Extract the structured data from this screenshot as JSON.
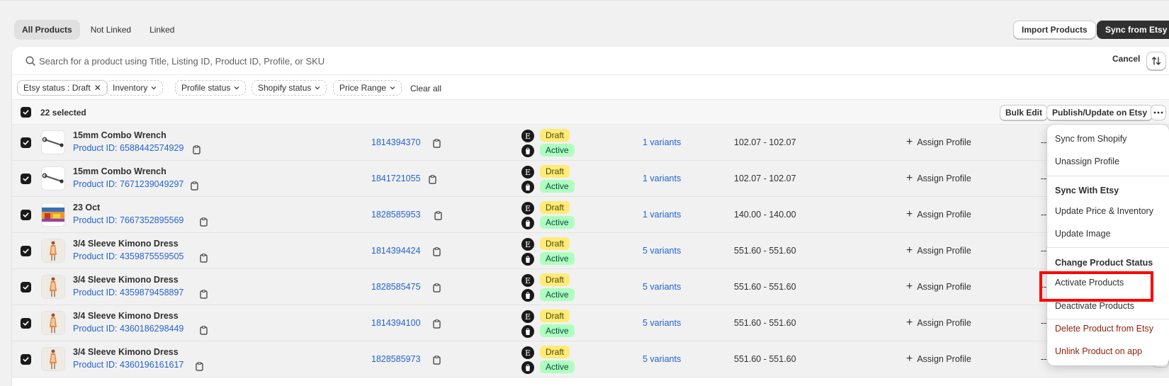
{
  "tabs": [
    "All Products",
    "Not Linked",
    "Linked"
  ],
  "header": {
    "import_label": "Import Products",
    "sync_label": "Sync from Etsy"
  },
  "search": {
    "placeholder": "Search for a product using Title, Listing ID, Product ID, Profile, or SKU",
    "cancel_label": "Cancel"
  },
  "filters": {
    "etsy_status": "Etsy status : Draft",
    "inventory": "Inventory",
    "profile_status": "Profile status",
    "shopify_status": "Shopify status",
    "price_range": "Price Range",
    "clear_all": "Clear all"
  },
  "selection": {
    "text": "22 selected",
    "bulk_edit": "Bulk Edit",
    "publish": "Publish/Update on Etsy"
  },
  "rows": [
    {
      "title": "15mm Combo Wrench",
      "product_id": "Product ID: 6588442574929",
      "listing_id": "1814394370",
      "etsy_status": "Draft",
      "shopify_status": "Active",
      "variants": "1 variants",
      "price": "102.07 - 102.07",
      "assign": "Assign Profile",
      "profile": "----",
      "thumb": "wrench"
    },
    {
      "title": "15mm Combo Wrench",
      "product_id": "Product ID: 7671239049297",
      "listing_id": "1841721055",
      "etsy_status": "Draft",
      "shopify_status": "Active",
      "variants": "1 variants",
      "price": "102.07 - 102.07",
      "assign": "Assign Profile",
      "profile": "----",
      "thumb": "wrench"
    },
    {
      "title": "23 Oct",
      "product_id": "Product ID: 7667352895569",
      "listing_id": "1828585953",
      "etsy_status": "Draft",
      "shopify_status": "Active",
      "variants": "1 variants",
      "price": "140.00 - 140.00",
      "assign": "Assign Profile",
      "profile": "----",
      "thumb": "painting"
    },
    {
      "title": "3/4 Sleeve Kimono Dress",
      "product_id": "Product ID: 4359875559505",
      "listing_id": "1814394424",
      "etsy_status": "Draft",
      "shopify_status": "Active",
      "variants": "5 variants",
      "price": "551.60 - 551.60",
      "assign": "Assign Profile",
      "profile": "----",
      "thumb": "dress"
    },
    {
      "title": "3/4 Sleeve Kimono Dress",
      "product_id": "Product ID: 4359879458897",
      "listing_id": "1828585475",
      "etsy_status": "Draft",
      "shopify_status": "Active",
      "variants": "5 variants",
      "price": "551.60 - 551.60",
      "assign": "Assign Profile",
      "profile": "----",
      "thumb": "dress"
    },
    {
      "title": "3/4 Sleeve Kimono Dress",
      "product_id": "Product ID: 4360186298449",
      "listing_id": "1814394100",
      "etsy_status": "Draft",
      "shopify_status": "Active",
      "variants": "5 variants",
      "price": "551.60 - 551.60",
      "assign": "Assign Profile",
      "profile": "----",
      "thumb": "dress"
    },
    {
      "title": "3/4 Sleeve Kimono Dress",
      "product_id": "Product ID: 4360196161617",
      "listing_id": "1828585973",
      "etsy_status": "Draft",
      "shopify_status": "Active",
      "variants": "5 variants",
      "price": "551.60 - 551.60",
      "assign": "Assign Profile",
      "profile": "----",
      "thumb": "dress"
    }
  ],
  "menu": {
    "sync_from_shopify": "Sync from Shopify",
    "unassign_profile": "Unassign Profile",
    "sync_with_etsy_heading": "Sync With Etsy",
    "update_price_inventory": "Update Price & Inventory",
    "update_image": "Update Image",
    "change_status_heading": "Change Product Status",
    "activate_products": "Activate Products",
    "deactivate_products": "Deactivate Products",
    "delete_from_etsy": "Delete Product from Etsy",
    "unlink_product": "Unlink Product on app"
  },
  "colors": {
    "link": "#2463d1",
    "draft_badge": "#ffeb78",
    "active_badge": "#affebf",
    "highlight": "#ff0000",
    "danger": "#8e1f0b"
  }
}
